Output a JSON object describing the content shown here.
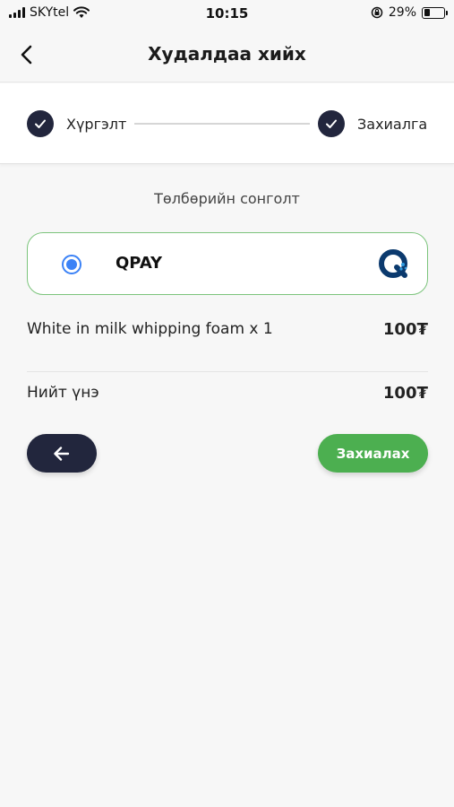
{
  "status_bar": {
    "carrier": "SKYtel",
    "time": "10:15",
    "battery_percent": "29%",
    "battery_level": 0.29,
    "icons": [
      "signal-icon",
      "wifi-icon",
      "orientation-lock-icon",
      "battery-icon"
    ]
  },
  "header": {
    "title": "Худалдаа хийх",
    "back_icon": "chevron-left-icon"
  },
  "stepper": {
    "steps": [
      {
        "label": "Хүргэлт",
        "completed": true
      },
      {
        "label": "Захиалга",
        "completed": true
      }
    ]
  },
  "payment": {
    "section_title": "Төлбөрийн сонголт",
    "options": [
      {
        "name": "QPAY",
        "selected": true,
        "logo": "qpay-logo-icon"
      }
    ]
  },
  "order": {
    "item": {
      "name": "White in milk whipping foam x 1",
      "price": "100₮"
    },
    "total": {
      "label": "Нийт үнэ",
      "price": "100₮"
    }
  },
  "actions": {
    "back_icon": "arrow-left-icon",
    "order_label": "Захиалах"
  },
  "colors": {
    "primary_dark": "#22263d",
    "accent_green": "#4caf50",
    "radio_blue": "#3b82f6",
    "option_border": "#7cc47c"
  }
}
